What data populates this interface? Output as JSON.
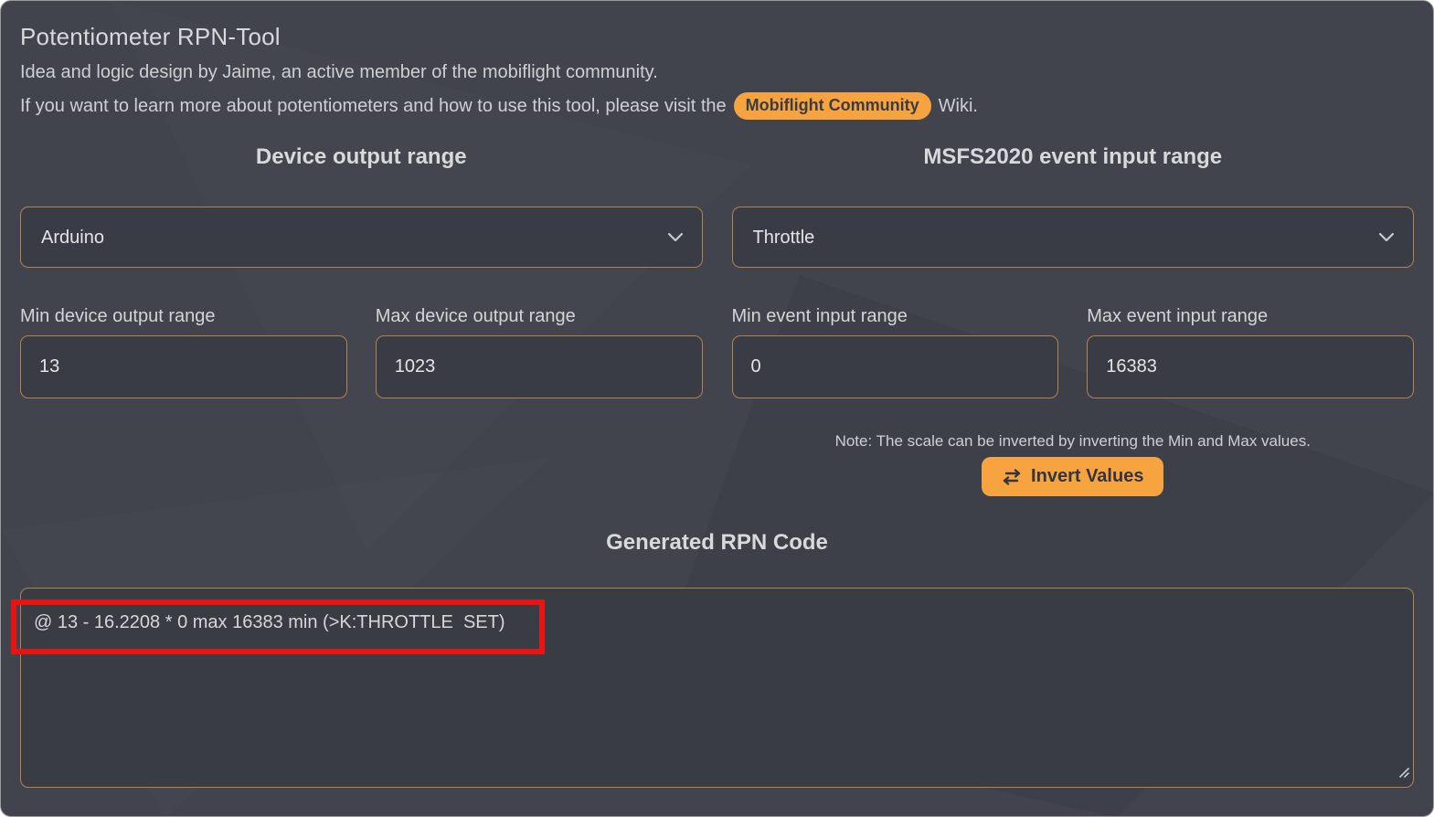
{
  "header": {
    "title": "Potentiometer RPN-Tool",
    "subtitle": "Idea and logic design by Jaime, an active member of the mobiflight community.",
    "info_prefix": "If you want to learn more about potentiometers and how to use this tool, please visit the",
    "link_label": "Mobiflight Community",
    "info_suffix": "Wiki."
  },
  "device": {
    "heading": "Device output range",
    "select_value": "Arduino",
    "min_label": "Min device output range",
    "min_value": "13",
    "max_label": "Max device output range",
    "max_value": "1023"
  },
  "event": {
    "heading": "MSFS2020 event input range",
    "select_value": "Throttle",
    "min_label": "Min event input range",
    "min_value": "0",
    "max_label": "Max event input range",
    "max_value": "16383",
    "note": "Note: The scale can be inverted by inverting the Min and Max values.",
    "invert_button_label": "Invert Values"
  },
  "output": {
    "heading": "Generated RPN Code",
    "code": "@ 13 - 16.2208 * 0 max 16383 min (>K:THROTTLE  SET)"
  },
  "icons": {
    "invert": "swap-arrows-icon",
    "select": "chevron-down-icon",
    "textarea": "resize-handle-icon"
  },
  "colors": {
    "accent_orange": "#f7a440",
    "field_border_orange": "#b5824f",
    "annotation_red": "#e81414",
    "background": "#41434d"
  }
}
